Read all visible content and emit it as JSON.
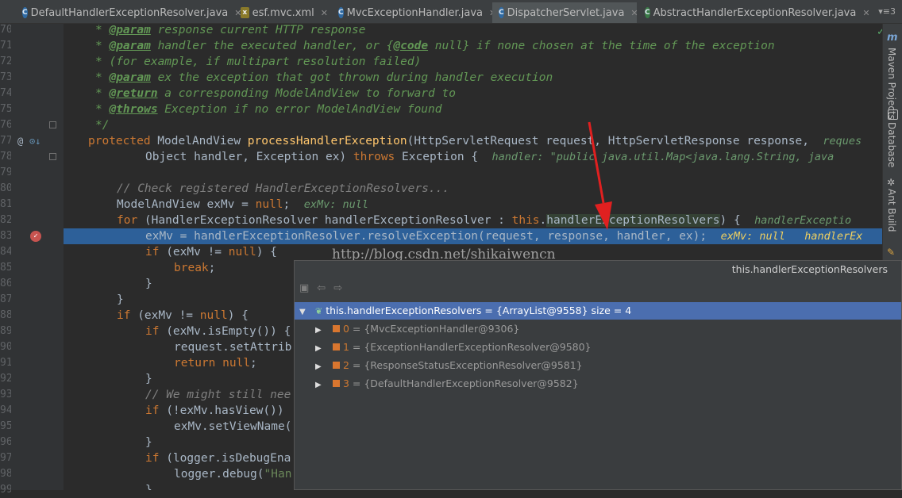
{
  "tabs": [
    {
      "label": "DefaultHandlerExceptionResolver.java",
      "icon": "class-icon",
      "active": false
    },
    {
      "label": "esf.mvc.xml",
      "icon": "xml-file-icon",
      "active": false
    },
    {
      "label": "MvcExceptionHandler.java",
      "icon": "class-icon",
      "active": false
    },
    {
      "label": "DispatcherServlet.java",
      "icon": "class-icon",
      "active": true
    },
    {
      "label": "AbstractHandlerExceptionResolver.java",
      "icon": "abstract-class-icon",
      "active": false
    }
  ],
  "tab_overflow": "▾≡3",
  "line_numbers": [
    "70",
    "71",
    "72",
    "73",
    "74",
    "75",
    "76",
    "77",
    "78",
    "79",
    "80",
    "81",
    "82",
    "83",
    "84",
    "85",
    "86",
    "87",
    "88",
    "89",
    "90",
    "91",
    "92",
    "93",
    "94",
    "95",
    "96",
    "97",
    "98",
    "99"
  ],
  "code": {
    "l70": [
      "* ",
      "@param",
      " response current HTTP response"
    ],
    "l71": [
      "* ",
      "@param",
      " handler the executed handler, or {",
      "@code",
      " null} if none chosen at the time of the exception"
    ],
    "l72": "* (for example, if multipart resolution failed)",
    "l73": [
      "* ",
      "@param",
      " ex the exception that got thrown during handler execution"
    ],
    "l74": [
      "* ",
      "@return",
      " a corresponding ModelAndView to forward to"
    ],
    "l75": [
      "* ",
      "@throws",
      " Exception if no error ModelAndView found"
    ],
    "l76": "*/",
    "l77": [
      "protected",
      " ModelAndView ",
      "processHandlerException",
      "(HttpServletRequest request, HttpServletResponse response,  ",
      "reques"
    ],
    "l78": [
      "Object handler, Exception ex) ",
      "throws",
      " Exception {  ",
      "handler: \"public java.util.Map<java.lang.String, java"
    ],
    "l80": "// Check registered HandlerExceptionResolvers...",
    "l81": [
      "ModelAndView exMv = ",
      "null",
      ";  ",
      "exMv: null"
    ],
    "l82": [
      "for",
      " (HandlerExceptionResolver handlerExceptionResolver : ",
      "this",
      ".",
      "handlerExceptionResolvers",
      ") {  ",
      "handlerExceptio"
    ],
    "l83": [
      "exMv = handlerExceptionResolver.resolveException(request, response, handler, ex);  ",
      "exMv: null   handlerEx"
    ],
    "l84": [
      "if",
      " (exMv != ",
      "null",
      ") {"
    ],
    "l85": [
      "break",
      ";"
    ],
    "l86": "}",
    "l87": "}",
    "l88": [
      "if",
      " (exMv != ",
      "null",
      ") {"
    ],
    "l89": [
      "if",
      " (exMv.isEmpty()) {"
    ],
    "l90": "request.setAttrib",
    "l91": [
      "return",
      " ",
      "null",
      ";"
    ],
    "l92": "}",
    "l93": "// We might still nee",
    "l94": [
      "if",
      " (!exMv.hasView())"
    ],
    "l95": "exMv.setViewName(",
    "l96": "}",
    "l97": [
      "if",
      " (logger.isDebugEna"
    ],
    "l98": [
      "logger.debug(",
      "\"Han"
    ],
    "l99": "}"
  },
  "watermark": "http://blog.csdn.net/shikaiwencn",
  "right_panels": [
    "Maven Projects",
    "Database",
    "Ant Build"
  ],
  "popup": {
    "title": "this.handlerExceptionResolvers",
    "root": {
      "name": "this.handlerExceptionResolvers",
      "value": " = {ArrayList@9558}  size = 4"
    },
    "items": [
      {
        "index": "0",
        "value": " = {MvcExceptionHandler@9306}"
      },
      {
        "index": "1",
        "value": " = {ExceptionHandlerExceptionResolver@9580}"
      },
      {
        "index": "2",
        "value": " = {ResponseStatusExceptionResolver@9581}"
      },
      {
        "index": "3",
        "value": " = {DefaultHandlerExceptionResolver@9582}"
      }
    ]
  },
  "colors": {
    "highlight_line": "#2d6099",
    "arrow": "#e02020",
    "selected_node": "#4b6eaf"
  }
}
